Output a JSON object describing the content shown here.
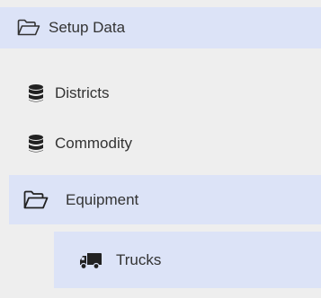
{
  "tree": {
    "setup_data": {
      "label": "Setup Data",
      "icon": "folder-open-icon",
      "expanded": true
    },
    "children": [
      {
        "label": "Districts",
        "icon": "database-icon"
      },
      {
        "label": "Commodity",
        "icon": "database-icon"
      },
      {
        "label": "Equipment",
        "icon": "folder-open-icon",
        "expanded": true,
        "children": [
          {
            "label": "Trucks",
            "icon": "truck-icon"
          }
        ]
      }
    ]
  },
  "colors": {
    "background": "#eeeeee",
    "highlight": "#dce3f7",
    "text": "#333333",
    "icon": "#333333"
  }
}
